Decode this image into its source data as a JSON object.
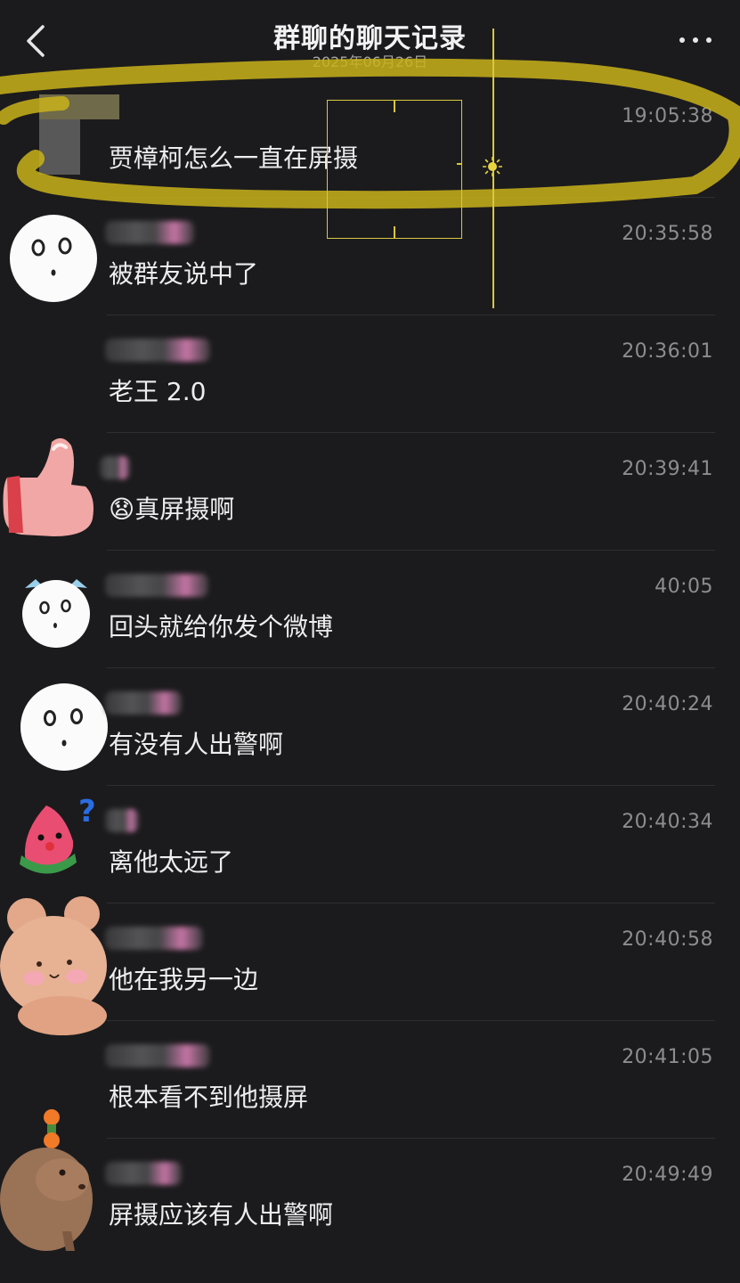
{
  "header": {
    "title": "群聊的聊天记录",
    "date": "2025年06月26日"
  },
  "messages": [
    {
      "time": "19:05:38",
      "text": "贾樟柯怎么一直在屏摄",
      "avatar": "pixelated-avatar"
    },
    {
      "time": "20:35:58",
      "text": "被群友说中了",
      "avatar": "surprised-face-avatar"
    },
    {
      "time": "20:36:01",
      "text": "老王 2.0",
      "avatar": "none"
    },
    {
      "time": "20:39:41",
      "text": "真屏摄啊",
      "emoji": "😧",
      "avatar": "thumbs-up-avatar"
    },
    {
      "time": "40:05",
      "text": "回头就给你发个微博",
      "avatar": "cat-face-avatar"
    },
    {
      "time": "20:40:24",
      "text": "有没有人出警啊",
      "avatar": "surprised-face-avatar"
    },
    {
      "time": "20:40:34",
      "text": "离他太远了",
      "avatar": "watermelon-avatar"
    },
    {
      "time": "20:40:58",
      "text": "他在我另一边",
      "avatar": "teddy-bear-avatar"
    },
    {
      "time": "20:41:05",
      "text": "根本看不到他摄屏",
      "avatar": "none"
    },
    {
      "time": "20:49:49",
      "text": "屏摄应该有人出警啊",
      "avatar": "capybara-avatar"
    }
  ],
  "colors": {
    "background": "#1b1b1d",
    "highlight": "#c9b21a",
    "focus": "#d8c840"
  }
}
